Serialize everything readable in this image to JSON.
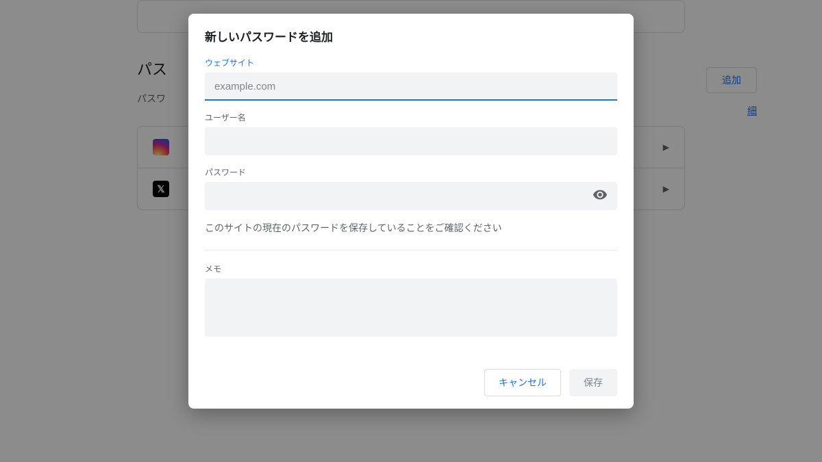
{
  "background": {
    "section_title_partial": "パス",
    "subtitle_partial": "パスワ",
    "add_button": "追加",
    "detail_link": "細",
    "row_chevron": "▶"
  },
  "dialog": {
    "title": "新しいパスワードを追加",
    "website": {
      "label": "ウェブサイト",
      "placeholder": "example.com",
      "value": ""
    },
    "username": {
      "label": "ユーザー名",
      "value": ""
    },
    "password": {
      "label": "パスワード",
      "value": ""
    },
    "help_text": "このサイトの現在のパスワードを保存していることをご確認ください",
    "note": {
      "label": "メモ",
      "value": ""
    },
    "actions": {
      "cancel": "キャンセル",
      "save": "保存"
    }
  }
}
